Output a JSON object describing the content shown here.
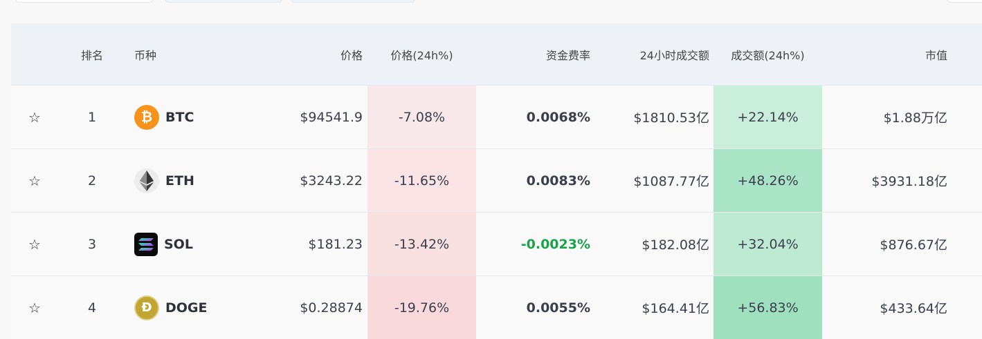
{
  "header": {
    "rank": "排名",
    "coin": "币种",
    "price": "价格",
    "price_change": "价格(24h%)",
    "funding_rate": "资金费率",
    "volume_24h": "24小时成交额",
    "volume_change": "成交额(24h%)",
    "market_cap": "市值"
  },
  "rows": [
    {
      "rank": "1",
      "symbol": "BTC",
      "price": "$94541.9",
      "price_change": "-7.08%",
      "funding_rate": "0.0068%",
      "volume": "$1810.53亿",
      "volume_change": "+22.14%",
      "market_cap": "$1.88万亿",
      "price_change_pct": -7.08,
      "volume_change_pct": 22.14,
      "icon": "btc-icon",
      "icon_color": "#f7931a"
    },
    {
      "rank": "2",
      "symbol": "ETH",
      "price": "$3243.22",
      "price_change": "-11.65%",
      "funding_rate": "0.0083%",
      "volume": "$1087.77亿",
      "volume_change": "+48.26%",
      "market_cap": "$3931.18亿",
      "price_change_pct": -11.65,
      "volume_change_pct": 48.26,
      "icon": "eth-icon",
      "icon_color": "#ececec"
    },
    {
      "rank": "3",
      "symbol": "SOL",
      "price": "$181.23",
      "price_change": "-13.42%",
      "funding_rate": "-0.0023%",
      "volume": "$182.08亿",
      "volume_change": "+32.04%",
      "market_cap": "$876.67亿",
      "price_change_pct": -13.42,
      "volume_change_pct": 32.04,
      "icon": "sol-icon",
      "icon_color": "#0b0b0b"
    },
    {
      "rank": "4",
      "symbol": "DOGE",
      "price": "$0.28874",
      "price_change": "-19.76%",
      "funding_rate": "0.0055%",
      "volume": "$164.41亿",
      "volume_change": "+56.83%",
      "market_cap": "$433.64亿",
      "price_change_pct": -19.76,
      "volume_change_pct": 56.83,
      "icon": "doge-icon",
      "icon_color": "#c2a633"
    }
  ],
  "colors": {
    "header_bg": "#eef2f6",
    "negative_heat": "#f9d9db",
    "positive_heat": "#9fe0bf",
    "negative_funding": "#1aa34a"
  }
}
